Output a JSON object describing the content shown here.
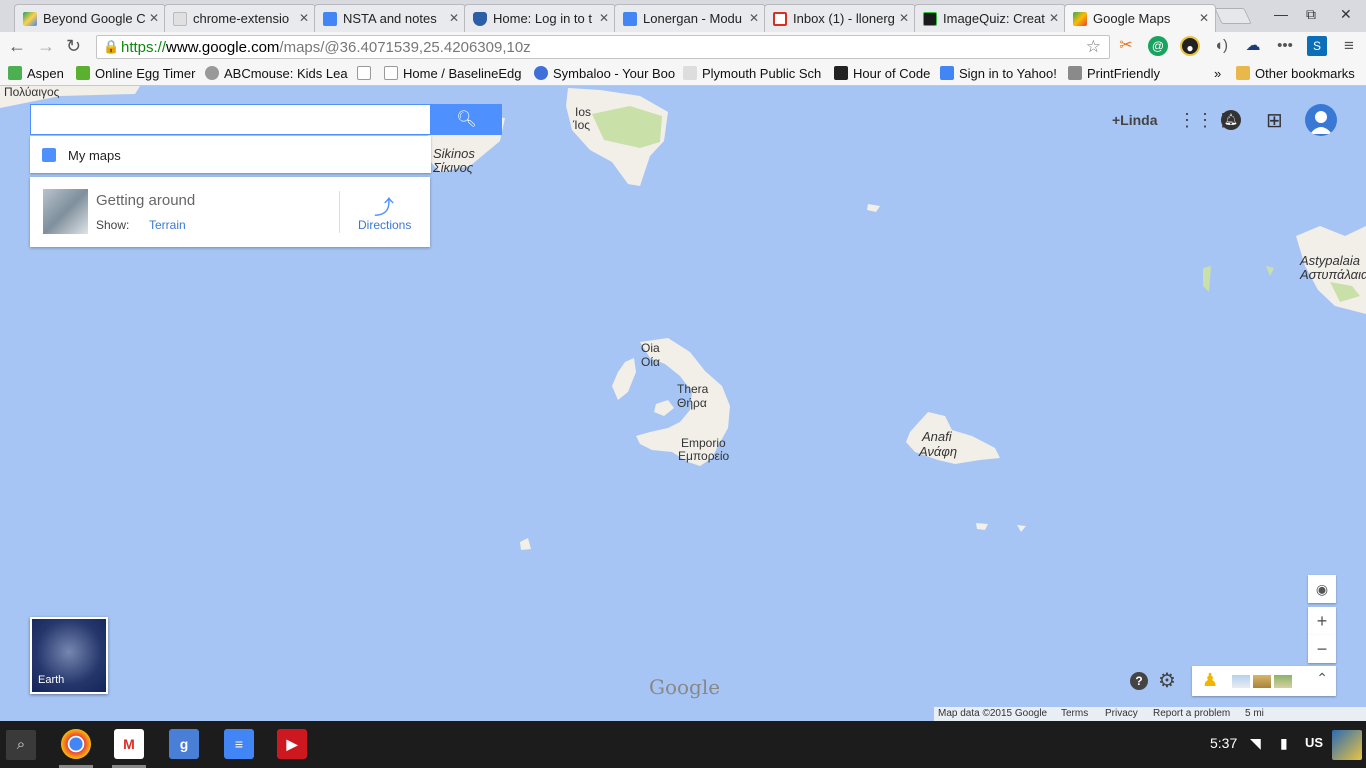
{
  "browser": {
    "tabs": [
      {
        "label": "Beyond Google C",
        "icon": "drive-icon"
      },
      {
        "label": "chrome-extensio",
        "icon": "page-icon"
      },
      {
        "label": "NSTA and notes",
        "icon": "docs-icon"
      },
      {
        "label": "Home: Log in to t",
        "icon": "shield-icon"
      },
      {
        "label": "Lonergan - Modu",
        "icon": "docs-icon"
      },
      {
        "label": "Inbox (1) - llonerg",
        "icon": "gmail-icon"
      },
      {
        "label": "ImageQuiz: Creat",
        "icon": "iq-icon"
      },
      {
        "label": "Google Maps",
        "icon": "maps-icon"
      }
    ],
    "active_tab": 7,
    "url": {
      "scheme": "https://",
      "host": "www.google.com",
      "path": "/maps/@36.4071539,25.4206309,10z"
    },
    "bookmarks": [
      {
        "label": "Aspen"
      },
      {
        "label": "Online Egg Timer"
      },
      {
        "label": "ABCmouse: Kids Lea"
      },
      {
        "label": ""
      },
      {
        "label": "Home / BaselineEdg"
      },
      {
        "label": "Symbaloo - Your Boo"
      },
      {
        "label": "Plymouth Public Sch"
      },
      {
        "label": "Hour of Code"
      },
      {
        "label": "Sign in to Yahoo!"
      },
      {
        "label": "PrintFriendly"
      }
    ],
    "overflow_label": "»",
    "other_bookmarks": "Other bookmarks"
  },
  "maps": {
    "search_placeholder": "",
    "my_maps_label": "My maps",
    "getting_around": {
      "title": "Getting around",
      "show_label": "Show:",
      "show_value": "Terrain",
      "directions_label": "Directions"
    },
    "user_label": "+Linda",
    "place_labels": {
      "polyaigos": "Πολύαιγος",
      "ios": "Ios",
      "ios_greek": "Ίος",
      "sikinos": "Sikinos",
      "sikinos_greek": "Σίκινος",
      "oia": "Oia",
      "oia_greek": "Οία",
      "thera": "Thera",
      "thera_greek": "Θήρα",
      "emporio": "Emporio",
      "emporio_greek": "Εμπορείο",
      "anafi": "Anafi",
      "anafi_greek": "Ανάφη",
      "astypalaia": "Astypalaia",
      "astypalaia_greek": "Αστυπάλαια"
    },
    "earth_label": "Earth",
    "logo": "Google",
    "footer": {
      "map_data": "Map data ©2015 Google",
      "terms": "Terms",
      "privacy": "Privacy",
      "report": "Report a problem",
      "scale": "5 mi"
    },
    "colors": {
      "water": "#a6c5f4",
      "land": "#f2efe9",
      "accent": "#4d90fe"
    }
  },
  "taskbar": {
    "time": "5:37",
    "locale": "US"
  }
}
